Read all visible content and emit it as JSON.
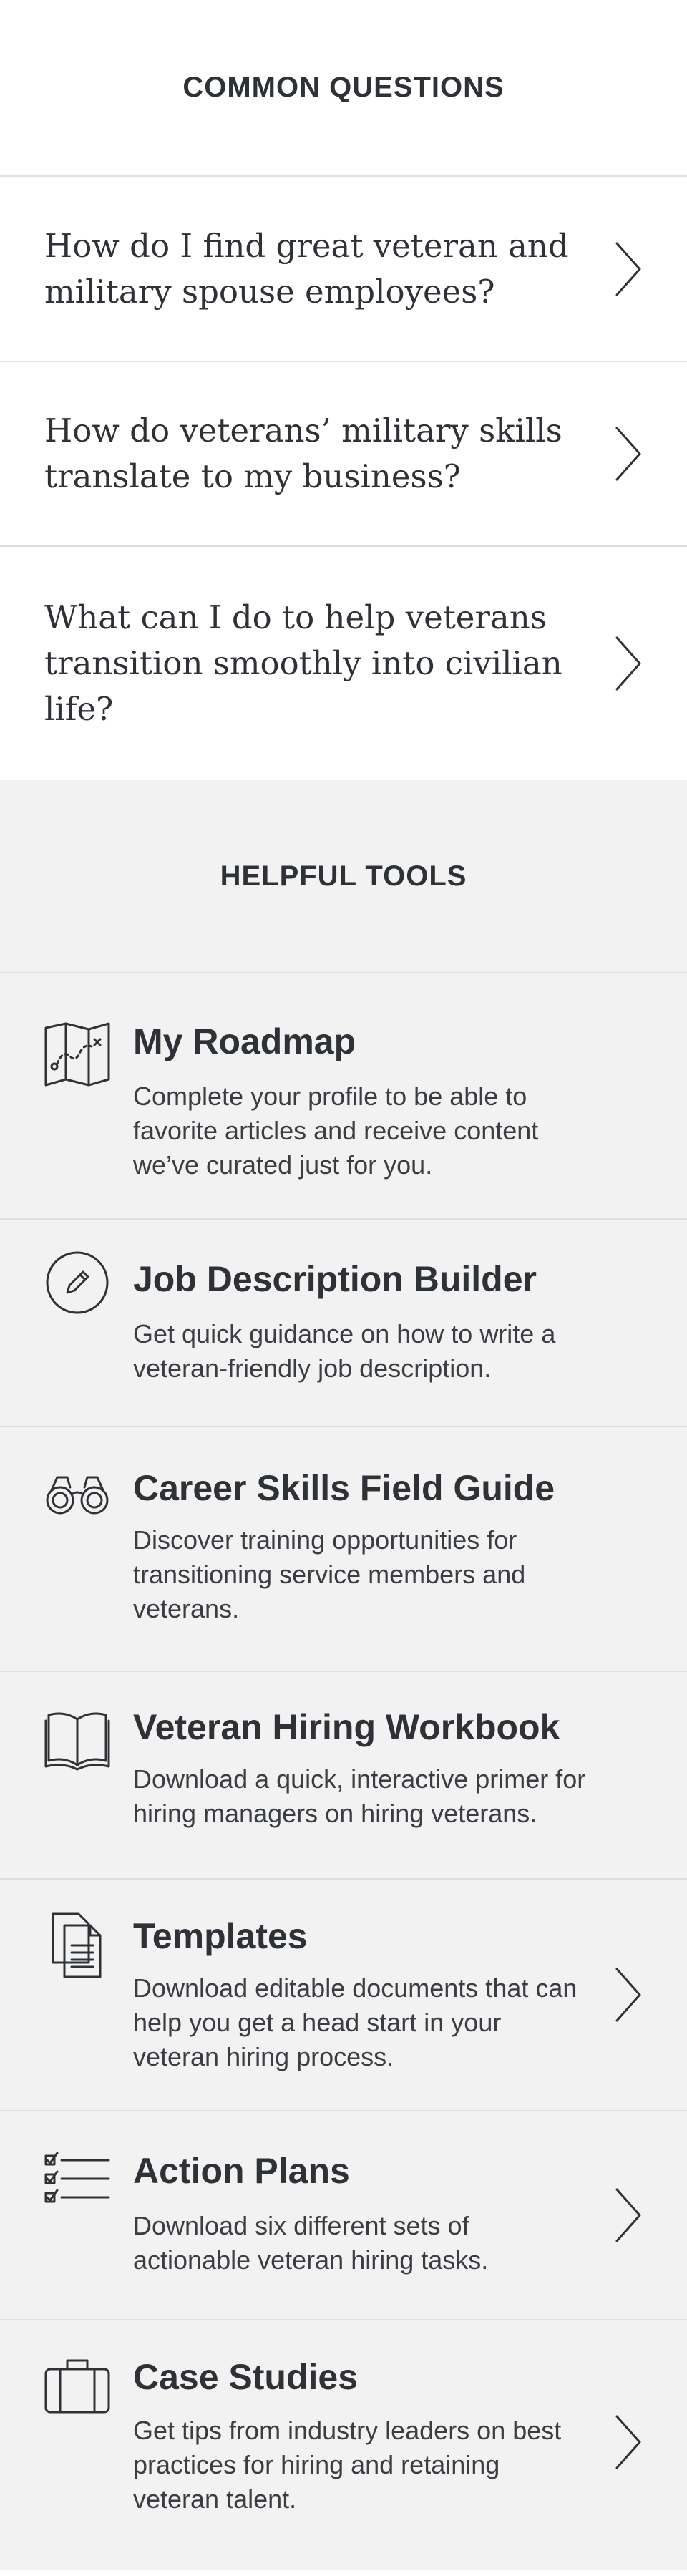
{
  "common_questions": {
    "heading": "COMMON QUESTIONS",
    "items": [
      {
        "text": "How do I find great veteran and military spouse employees?",
        "icon": "chevron-right-icon"
      },
      {
        "text": "How do veterans’ military skills translate to my business?",
        "icon": "chevron-right-icon"
      },
      {
        "text": "What can I do to help veterans transition smoothly into civilian life?",
        "icon": "chevron-right-icon"
      }
    ]
  },
  "helpful_tools": {
    "heading": "HELPFUL TOOLS",
    "items": [
      {
        "title": "My Roadmap",
        "description": "Complete your profile to be able to favorite articles and receive content we’ve curated just for you.",
        "icon": "map-icon"
      },
      {
        "title": "Job Description Builder",
        "description": "Get quick guidance on how to write a veteran-friendly job description.",
        "icon": "pencil-circle-icon"
      },
      {
        "title": "Career Skills Field Guide",
        "description": "Discover training opportunities for transitioning service members and veterans.",
        "icon": "binoculars-icon"
      },
      {
        "title": "Veteran Hiring Workbook",
        "description": "Download a quick, interactive primer for hiring managers on hiring veterans.",
        "icon": "open-book-icon"
      },
      {
        "title": "Templates",
        "description": "Download editable documents that can help you get a head start in your veteran hiring process.",
        "icon": "documents-icon"
      },
      {
        "title": "Action Plans",
        "description": "Download six different sets of actionable veteran hiring tasks.",
        "icon": "checklist-icon"
      },
      {
        "title": "Case Studies",
        "description": "Get tips from industry leaders on best practices for hiring and retaining veteran talent.",
        "icon": "briefcase-icon"
      }
    ]
  },
  "colors": {
    "text": "#2e3135",
    "tools_background": "#f2f2f2",
    "divider": "#dedede"
  }
}
